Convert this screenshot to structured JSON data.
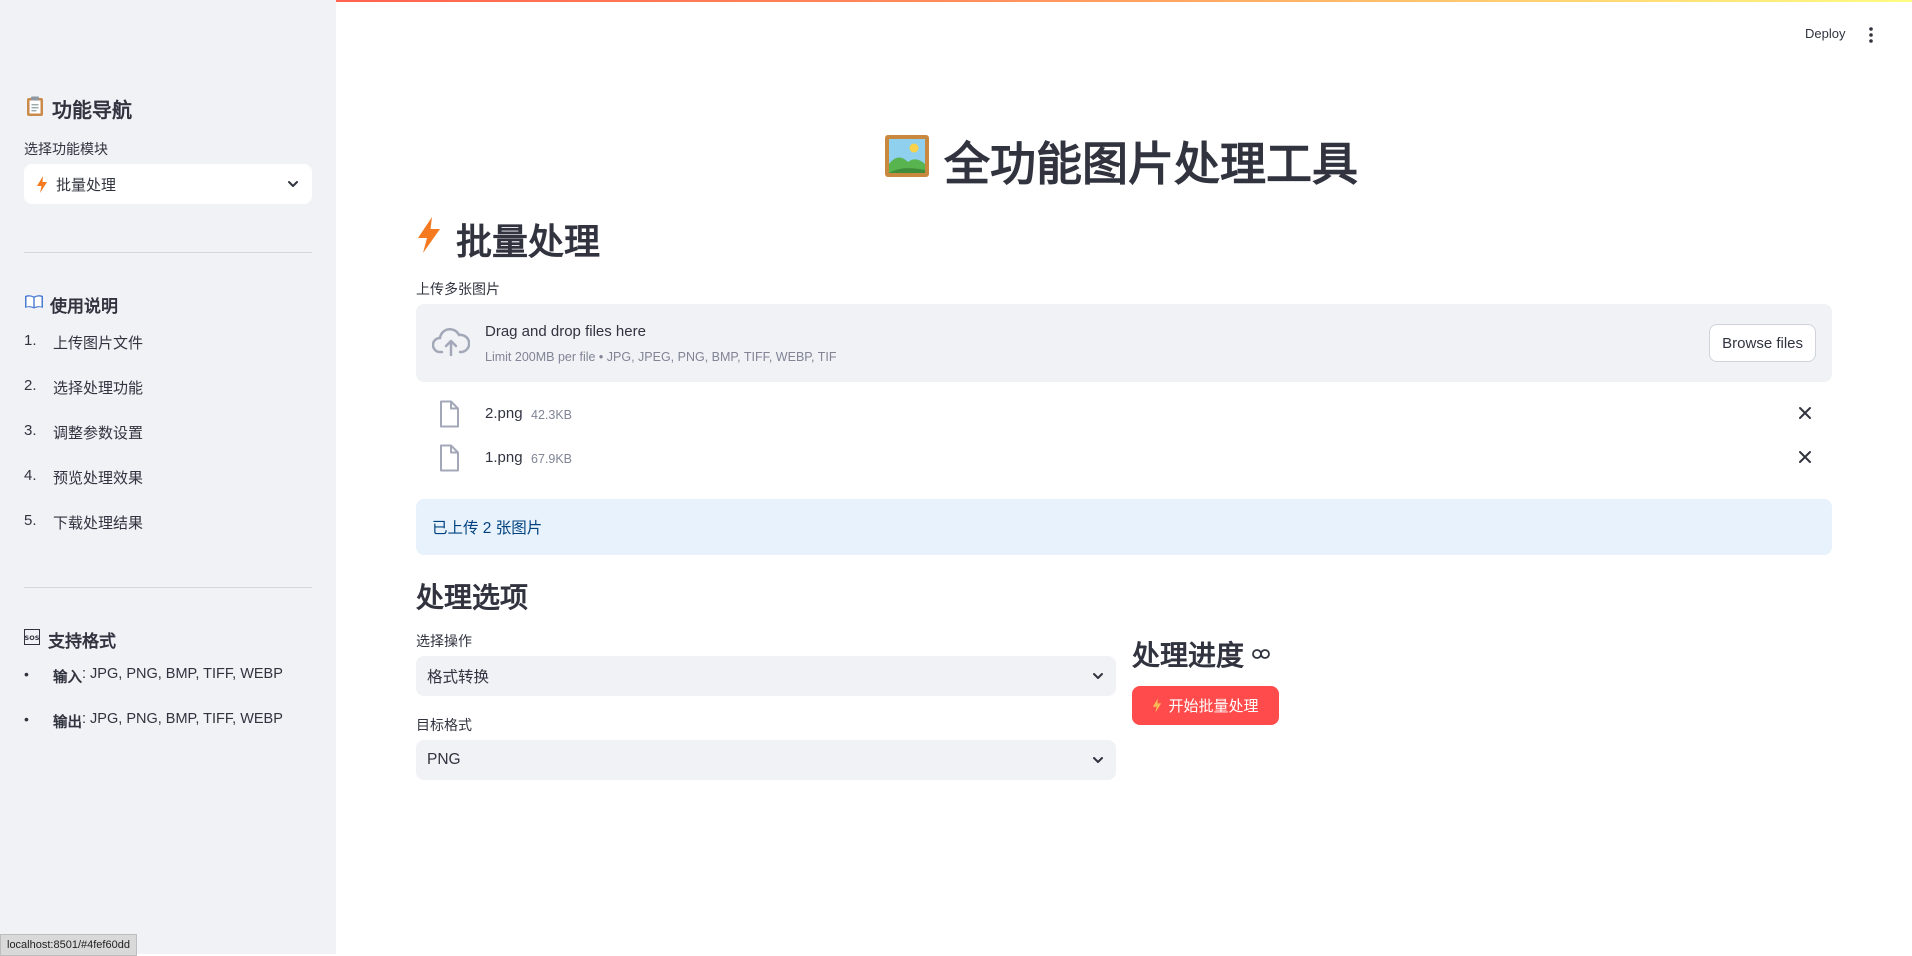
{
  "header": {
    "deploy_label": "Deploy",
    "menu_icon": "more-vertical-icon"
  },
  "sidebar": {
    "nav_title": "功能导航",
    "select_label": "选择功能模块",
    "selected_module": "批量处理",
    "instructions_title": "使用说明",
    "steps": [
      {
        "num": "1.",
        "text": "上传图片文件"
      },
      {
        "num": "2.",
        "text": "选择处理功能"
      },
      {
        "num": "3.",
        "text": "调整参数设置"
      },
      {
        "num": "4.",
        "text": "预览处理效果"
      },
      {
        "num": "5.",
        "text": "下载处理结果"
      }
    ],
    "formats_title": "支持格式",
    "formats": [
      {
        "name": "输入",
        "value": ": JPG, PNG, BMP, TIFF, WEBP"
      },
      {
        "name": "输出",
        "value": ": JPG, PNG, BMP, TIFF, WEBP"
      }
    ]
  },
  "main": {
    "title": "全功能图片处理工具",
    "section_title": "批量处理",
    "upload_label": "上传多张图片",
    "dropzone": {
      "title": "Drag and drop files here",
      "limit": "Limit 200MB per file • JPG, JPEG, PNG, BMP, TIFF, WEBP, TIF",
      "browse_label": "Browse files"
    },
    "files": [
      {
        "name": "2.png",
        "size": "42.3KB"
      },
      {
        "name": "1.png",
        "size": "67.9KB"
      }
    ],
    "info_message": "已上传 2 张图片",
    "options_title": "处理选项",
    "operation_label": "选择操作",
    "operation_value": "格式转换",
    "format_label": "目标格式",
    "format_value": "PNG",
    "progress_title": "处理进度",
    "start_button_label": "开始批量处理"
  },
  "statusbar": {
    "url": "localhost:8501/#4fef60dd"
  },
  "colors": {
    "primary": "#ff4b4b",
    "sidebar_bg": "#f0f2f6",
    "info_bg": "#e8f2fc",
    "info_text": "#004280"
  }
}
